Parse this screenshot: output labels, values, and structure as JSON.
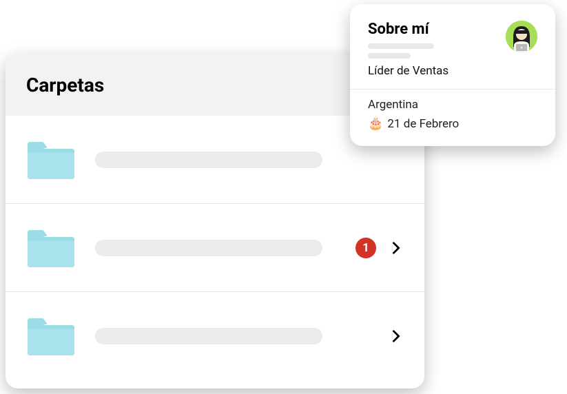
{
  "folders": {
    "title": "Carpetas",
    "items": [
      {
        "badge": null,
        "chevron": false
      },
      {
        "badge": "1",
        "chevron": true
      },
      {
        "badge": null,
        "chevron": true
      }
    ]
  },
  "about": {
    "title": "Sobre mí",
    "role": "Líder de Ventas",
    "country": "Argentina",
    "birthday": "21 de Febrero"
  }
}
